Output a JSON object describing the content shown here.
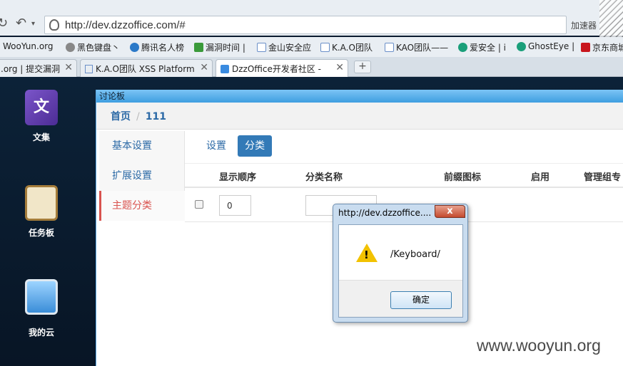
{
  "browser": {
    "url": "http://dev.dzzoffice.com/#",
    "accelerator": "加速器",
    "bookmarks": [
      {
        "label": "WooYun.org"
      },
      {
        "label": "黑色键盘丶"
      },
      {
        "label": "腾讯名人榜"
      },
      {
        "label": "漏洞时间 |"
      },
      {
        "label": "金山安全应"
      },
      {
        "label": "K.A.O团队"
      },
      {
        "label": "KAO团队——"
      },
      {
        "label": "爱安全 | i"
      },
      {
        "label": "GhostEye |"
      },
      {
        "label": "京东商城"
      }
    ],
    "tabs": [
      {
        "label": ".org | 提交漏洞"
      },
      {
        "label": "K.A.O团队 XSS Platform"
      },
      {
        "label": "DzzOffice开发者社区 - "
      }
    ],
    "new_tab": "+",
    "close_glyph": "✕"
  },
  "desktop": {
    "icons": [
      {
        "label": "文集",
        "glyph": "文"
      },
      {
        "label": "任务板"
      },
      {
        "label": "我的云"
      }
    ]
  },
  "app": {
    "window_title": "讨论板",
    "breadcrumb": {
      "home": "首页",
      "separator": "/",
      "current": "111"
    },
    "left_nav": [
      "基本设置",
      "扩展设置",
      "主题分类"
    ],
    "pills": [
      "设置",
      "分类"
    ],
    "table": {
      "headers": [
        "显示顺序",
        "分类名称",
        "前缀图标",
        "启用",
        "管理组专"
      ],
      "row": {
        "order_value": "0",
        "name_value": ""
      }
    }
  },
  "alert": {
    "title": "http://dev.dzzoffice....",
    "close": "x",
    "icon_mark": "!",
    "message": "/Keyboard/",
    "ok_label": "确定"
  },
  "watermark": "www.wooyun.org",
  "colors": {
    "accent": "#337ab7",
    "active_nav": "#d9534f",
    "link": "#2c6aa6"
  }
}
